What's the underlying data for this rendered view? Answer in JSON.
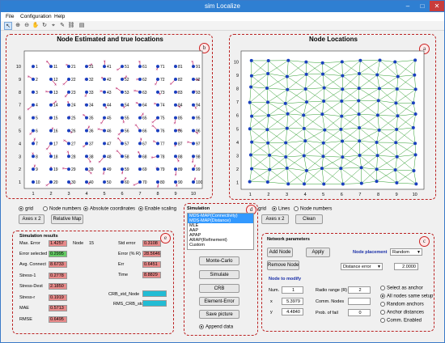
{
  "window": {
    "title": "sim Localize"
  },
  "menu": [
    "File",
    "Configuration",
    "Help"
  ],
  "panel_b": {
    "title": "Node Estimated and true locations",
    "badge": "b",
    "xticks": [
      "1",
      "2",
      "3",
      "4",
      "5",
      "6",
      "7",
      "8",
      "9",
      "10"
    ],
    "yticks": [
      "1",
      "2",
      "3",
      "4",
      "5",
      "6",
      "7",
      "8",
      "9",
      "10"
    ],
    "node_labels": [
      [
        "1",
        "11",
        "21",
        "31",
        "41",
        "51",
        "61",
        "71",
        "81",
        "91"
      ],
      [
        "2",
        "12",
        "22",
        "32",
        "42",
        "52",
        "62",
        "72",
        "82",
        "92"
      ],
      [
        "3",
        "13",
        "23",
        "33",
        "43",
        "53",
        "63",
        "73",
        "83",
        "93"
      ],
      [
        "4",
        "14",
        "24",
        "34",
        "44",
        "54",
        "64",
        "74",
        "84",
        "94"
      ],
      [
        "5",
        "15",
        "25",
        "35",
        "45",
        "55",
        "65",
        "75",
        "85",
        "95"
      ],
      [
        "6",
        "16",
        "26",
        "36",
        "46",
        "56",
        "66",
        "76",
        "86",
        "96"
      ],
      [
        "7",
        "17",
        "27",
        "37",
        "47",
        "57",
        "67",
        "77",
        "87",
        "97"
      ],
      [
        "8",
        "18",
        "28",
        "38",
        "48",
        "58",
        "68",
        "78",
        "88",
        "98"
      ],
      [
        "9",
        "19",
        "29",
        "39",
        "49",
        "59",
        "69",
        "79",
        "89",
        "99"
      ],
      [
        "10",
        "20",
        "30",
        "40",
        "50",
        "60",
        "70",
        "80",
        "90",
        "100"
      ]
    ]
  },
  "panel_a": {
    "title": "Node Locations",
    "badge": "a",
    "xticks": [
      "1",
      "2",
      "3",
      "4",
      "5",
      "6",
      "7",
      "8",
      "9",
      "10"
    ],
    "yticks": [
      "1",
      "2",
      "3",
      "4",
      "5",
      "6",
      "7",
      "8",
      "9",
      "10"
    ]
  },
  "left_controls": {
    "grid": "grid",
    "node_numbers": "Node numbers",
    "absolute": "Absolute coordinates",
    "scaling": "Enable scaling",
    "axes": "Axes x 2",
    "relative": "Relative Map"
  },
  "right_controls": {
    "grid": "grid",
    "lines": "Lines",
    "node_numbers": "Node numbers",
    "axes": "Axes x 2",
    "clean": "Clean"
  },
  "simulation": {
    "label": "Simulation",
    "badge": "d",
    "options": [
      "MDS-MAP(Connectivity)",
      "MDS-MAP(Distance)",
      "MLE",
      "AAP",
      "APAP",
      "ARAP(Refinement)",
      "Custom"
    ],
    "buttons": [
      "Monte-Carlo",
      "Simulate",
      "CRB",
      "Element-Error",
      "Save picture"
    ],
    "append": "Append data"
  },
  "results": {
    "title": "Simulation results",
    "badge": "e",
    "node_label": "Node",
    "node_value": "15",
    "rows": [
      {
        "label": "Max. Error",
        "value": "1.4257"
      },
      {
        "label": "Error selected",
        "value": "0.2995"
      },
      {
        "label": "Avg. Connect",
        "value": "8.6733"
      },
      {
        "label": "Stress-1",
        "value": "0.2778"
      },
      {
        "label": "Stress-Dest",
        "value": "2.1850"
      },
      {
        "label": "Stress-r",
        "value": "0.1919"
      },
      {
        "label": "MAE",
        "value": "0.5713"
      },
      {
        "label": "RMSE",
        "value": "0.6495"
      }
    ],
    "right_rows": [
      {
        "label": "Std error",
        "value": "0.3108"
      },
      {
        "label": "Error (% R)",
        "value": "28.5646"
      },
      {
        "label": "Err",
        "value": "0.6451"
      },
      {
        "label": "Time",
        "value": "8.8829"
      }
    ],
    "crb_node": "CRB_std_Node",
    "rms_crb": "RMS_CRB_std"
  },
  "network": {
    "title": "Network parameters",
    "badge": "c",
    "add": "Add Node",
    "apply": "Apply",
    "remove": "Remove Node",
    "placement_label": "Node placement",
    "placement_value": "Random",
    "dist_value": "Distance error",
    "dist_num": "2.0000",
    "modify_label": "Node to modify",
    "num_label": "Num.",
    "num_value": "1",
    "x_label": "x",
    "x_value": "5.3979",
    "y_label": "y",
    "y_value": "4.4840",
    "range_label": "Radio range (R)",
    "range_value": "2",
    "comm_label": "Comm. Nodes",
    "comm_value": "",
    "prob_label": "Prob. of fail",
    "prob_value": "0",
    "anchor_options": [
      "Select as anchor",
      "All nodes same setup",
      "Random anchors",
      "Anchor distances",
      "Comm. Enabled"
    ]
  }
}
